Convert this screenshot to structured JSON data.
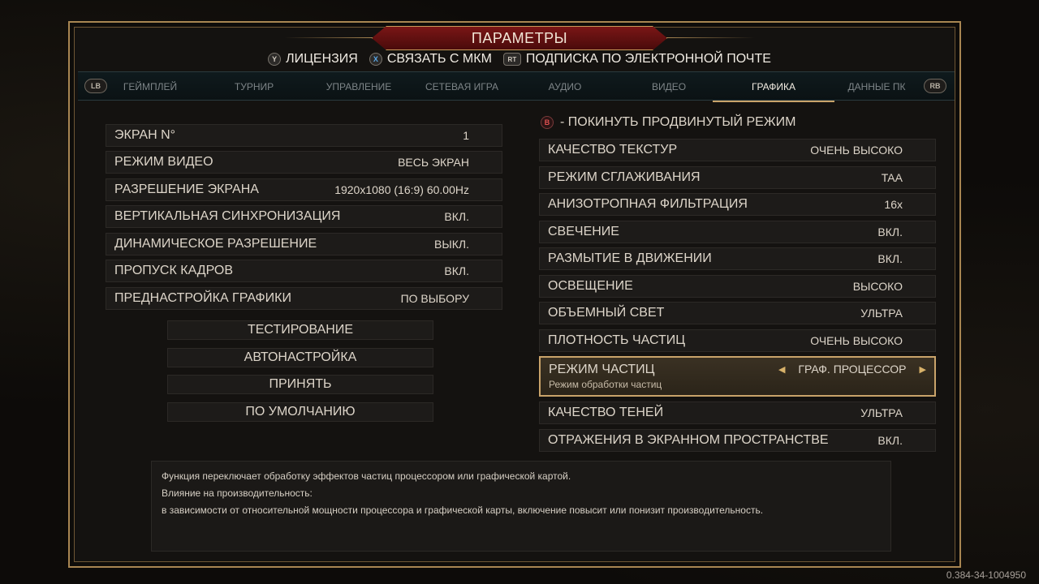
{
  "header": {
    "title": "ПАРАМЕТРЫ",
    "shortcuts": [
      {
        "key": "Y",
        "icon": "y-button-icon",
        "label": "ЛИЦЕНЗИЯ"
      },
      {
        "key": "X",
        "icon": "x-button-icon",
        "label": "СВЯЗАТЬ С МКМ"
      },
      {
        "key": "RT",
        "icon": "rt-button-icon",
        "label": "ПОДПИСКА ПО ЭЛЕКТРОННОЙ ПОЧТЕ"
      }
    ]
  },
  "tabs": {
    "lb": "LB",
    "rb": "RB",
    "items": [
      {
        "label": "ГЕЙМПЛЕЙ"
      },
      {
        "label": "ТУРНИР"
      },
      {
        "label": "УПРАВЛЕНИЕ"
      },
      {
        "label": "СЕТЕВАЯ ИГРА"
      },
      {
        "label": "АУДИО"
      },
      {
        "label": "ВИДЕО"
      },
      {
        "label": "ГРАФИКА"
      },
      {
        "label": "ДАННЫЕ ПК"
      }
    ],
    "active": "ГРАФИКА"
  },
  "left": {
    "settings": [
      {
        "label": "ЭКРАН N°",
        "value": "1"
      },
      {
        "label": "РЕЖИМ ВИДЕО",
        "value": "ВЕСЬ ЭКРАН"
      },
      {
        "label": "РАЗРЕШЕНИЕ ЭКРАНА",
        "value": "1920x1080 (16:9) 60.00Hz"
      },
      {
        "label": "ВЕРТИКАЛЬНАЯ СИНХРОНИЗАЦИЯ",
        "value": "ВКЛ."
      },
      {
        "label": "ДИНАМИЧЕСКОЕ РАЗРЕШЕНИЕ",
        "value": "ВЫКЛ."
      },
      {
        "label": "ПРОПУСК КАДРОВ",
        "value": "ВКЛ."
      },
      {
        "label": "ПРЕДНАСТРОЙКА ГРАФИКИ",
        "value": "ПО ВЫБОРУ"
      }
    ],
    "actions": [
      {
        "label": "ТЕСТИРОВАНИЕ"
      },
      {
        "label": "АВТОНАСТРОЙКА"
      },
      {
        "label": "ПРИНЯТЬ"
      },
      {
        "label": "ПО УМОЛЧАНИЮ"
      }
    ]
  },
  "right": {
    "exit_key": "B",
    "exit_label": "- ПОКИНУТЬ ПРОДВИНУТЫЙ РЕЖИМ",
    "settings": [
      {
        "label": "КАЧЕСТВО ТЕКСТУР",
        "value": "ОЧЕНЬ ВЫСОКО"
      },
      {
        "label": "РЕЖИМ СГЛАЖИВАНИЯ",
        "value": "TAA"
      },
      {
        "label": "АНИЗОТРОПНАЯ ФИЛЬТРАЦИЯ",
        "value": "16x"
      },
      {
        "label": "СВЕЧЕНИЕ",
        "value": "ВКЛ."
      },
      {
        "label": "РАЗМЫТИЕ В ДВИЖЕНИИ",
        "value": "ВКЛ."
      },
      {
        "label": "ОСВЕЩЕНИЕ",
        "value": "ВЫСОКО"
      },
      {
        "label": "ОБЪЕМНЫЙ СВЕТ",
        "value": "УЛЬТРА"
      },
      {
        "label": "ПЛОТНОСТЬ ЧАСТИЦ",
        "value": "ОЧЕНЬ ВЫСОКО"
      }
    ],
    "selected": {
      "label": "РЕЖИМ ЧАСТИЦ",
      "sublabel": "Режим обработки частиц",
      "value": "ГРАФ. ПРОЦЕССОР"
    },
    "settings_after": [
      {
        "label": "КАЧЕСТВО ТЕНЕЙ",
        "value": "УЛЬТРА"
      },
      {
        "label": "ОТРАЖЕНИЯ В ЭКРАННОМ ПРОСТРАНСТВЕ",
        "value": "ВКЛ."
      }
    ]
  },
  "description": {
    "lines": [
      "Функция переключает обработку эффектов частиц процессором или графической картой.",
      "Влияние на производительность:",
      "в зависимости от относительной мощности процессора и графической карты, включение повысит или понизит производительность."
    ]
  },
  "version": "0.384-34-1004950"
}
